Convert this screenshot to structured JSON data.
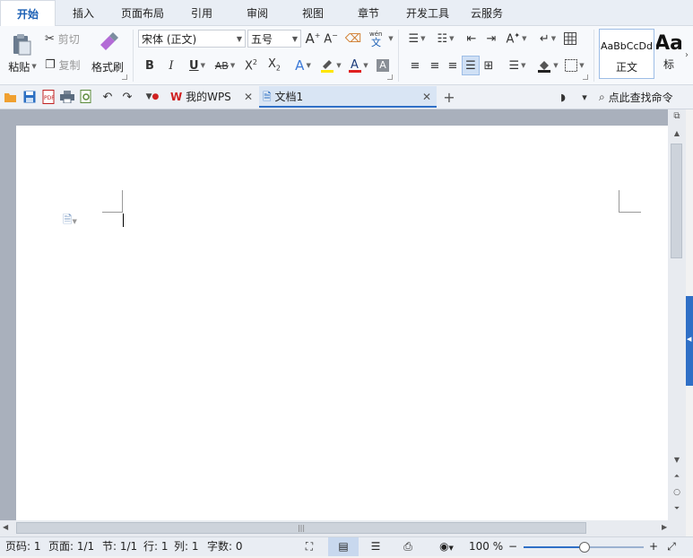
{
  "menu": {
    "tabs": [
      "开始",
      "插入",
      "页面布局",
      "引用",
      "审阅",
      "视图",
      "章节",
      "开发工具",
      "云服务"
    ],
    "active_index": 0
  },
  "ribbon": {
    "paste": "粘贴",
    "cut": "剪切",
    "copy": "复制",
    "format_painter": "格式刷",
    "font_name": "宋体 (正文)",
    "font_size": "五号",
    "style_preview_normal": "AaBbCcDd",
    "style_normal_label": "正文",
    "style_preview_heading": "Aa",
    "style_heading_label": "标",
    "wen_label": "wén\n文"
  },
  "quickbar": {
    "doc_tabs": [
      {
        "label": "我的WPS"
      },
      {
        "label": "文档1"
      }
    ],
    "search_label": "点此查找命令",
    "new_tab": "+"
  },
  "status": {
    "page": "页码: 1",
    "pages": "页面: 1/1",
    "section": "节: 1/1",
    "row": "行: 1",
    "col": "列: 1",
    "words": "字数: 0",
    "zoom": "100 %",
    "zoom_fraction": 0.5
  },
  "colors": {
    "accent": "#1a5fb4",
    "font_color_bar": "#e02020",
    "highlight_bar": "#ffe600",
    "doc_bg": "#a9b0bc",
    "side_tab": "#2f6fc6"
  },
  "icons": [
    "paste-icon",
    "scissors-icon",
    "copy-icon",
    "brush-icon",
    "bold-icon",
    "italic-icon",
    "underline-icon",
    "strike-icon",
    "superscript-icon",
    "subscript-icon",
    "font-grow-icon",
    "font-shrink-icon",
    "clear-format-icon",
    "pinyin-icon",
    "bullet-list-icon",
    "numbered-list-icon",
    "indent-icon",
    "outdent-icon",
    "align-left-icon",
    "align-center-icon",
    "align-right-icon",
    "justify-icon",
    "distribute-icon",
    "line-spacing-icon",
    "shading-icon",
    "border-icon",
    "table-icon",
    "open-icon",
    "save-icon",
    "pdf-icon",
    "print-icon",
    "preview-icon",
    "undo-icon",
    "redo-icon",
    "search-icon"
  ]
}
